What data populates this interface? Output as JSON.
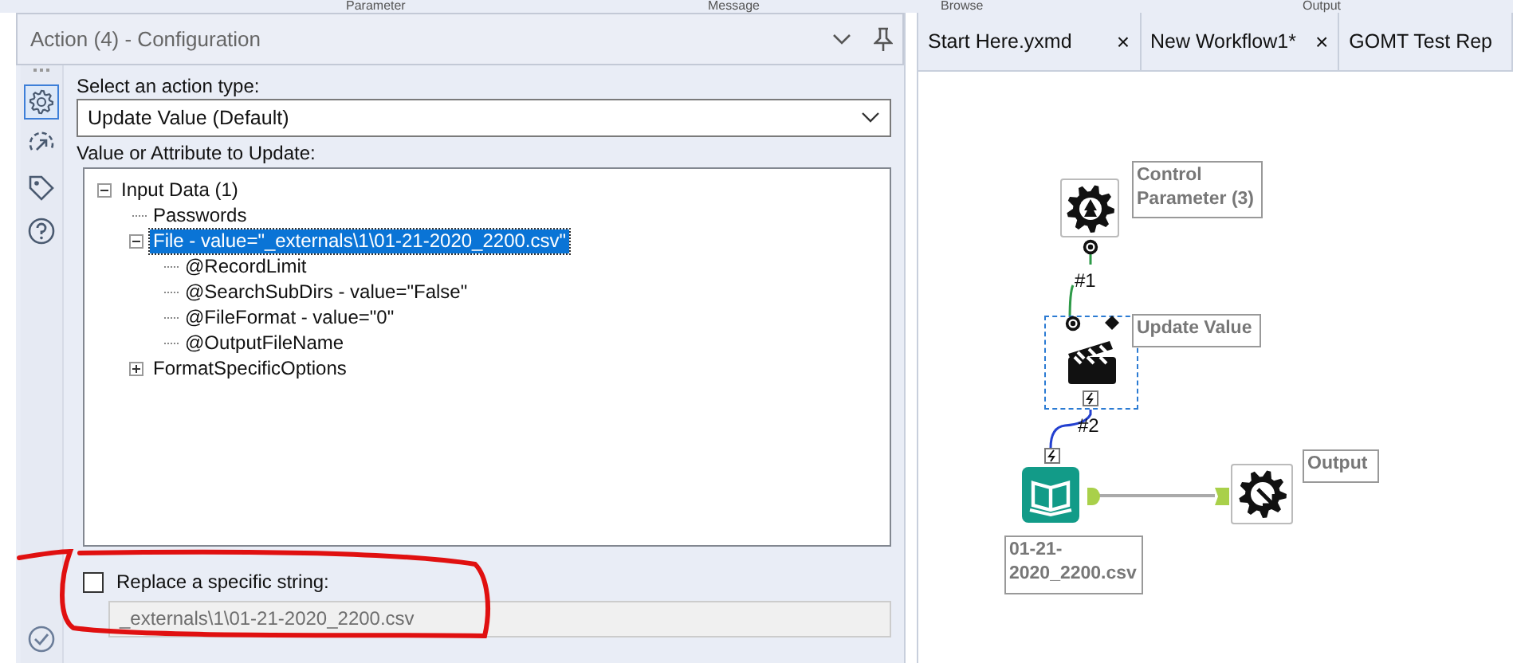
{
  "top_strip": [
    {
      "label": "Parameter"
    },
    {
      "label": "Message"
    },
    {
      "label": "Browse"
    },
    {
      "label": "Output"
    }
  ],
  "panel": {
    "title": "Action (4) - Configuration"
  },
  "sidebar": {
    "items": [
      {
        "kind": "gear",
        "selected": true
      },
      {
        "kind": "connect",
        "selected": false
      },
      {
        "kind": "tag",
        "selected": false
      },
      {
        "kind": "help",
        "selected": false
      }
    ]
  },
  "action_type": {
    "label": "Select an action type:",
    "value": "Update Value (Default)"
  },
  "tree": {
    "label": "Value or Attribute to Update:",
    "items": [
      {
        "text": "Input Data (1)",
        "expanded": true,
        "selected": false,
        "children": [
          {
            "text": "Passwords",
            "selected": false
          },
          {
            "text": "File - value=\"_externals\\1\\01-21-2020_2200.csv\"",
            "expanded": true,
            "selected": true,
            "children": [
              {
                "text": "@RecordLimit",
                "selected": false
              },
              {
                "text": "@SearchSubDirs - value=\"False\"",
                "selected": false
              },
              {
                "text": "@FileFormat - value=\"0\"",
                "selected": false
              },
              {
                "text": "@OutputFileName",
                "selected": false
              }
            ]
          },
          {
            "text": "FormatSpecificOptions",
            "expanded": false,
            "selected": false
          }
        ]
      }
    ]
  },
  "replace": {
    "label": "Replace a specific string:",
    "checked": false,
    "value": "_externals\\1\\01-21-2020_2200.csv",
    "disabled": true
  },
  "tabs": [
    {
      "label": "Start Here.yxmd",
      "close": "×"
    },
    {
      "label": "New Workflow1*",
      "close": "×"
    },
    {
      "label": "GOMT Test Rep"
    }
  ],
  "canvas": {
    "nodes": [
      {
        "kind": "control_parameter",
        "label": "Control Parameter (3)",
        "selected": false
      },
      {
        "kind": "action",
        "label": "Update Value",
        "selected": true
      },
      {
        "kind": "input",
        "label": "01-21-2020_2200.csv",
        "selected": false
      },
      {
        "kind": "output",
        "label": "Output",
        "selected": false
      }
    ],
    "connections": [
      {
        "kind": "control",
        "label": "#1"
      },
      {
        "kind": "action",
        "label": "#2"
      },
      {
        "kind": "data"
      }
    ]
  }
}
